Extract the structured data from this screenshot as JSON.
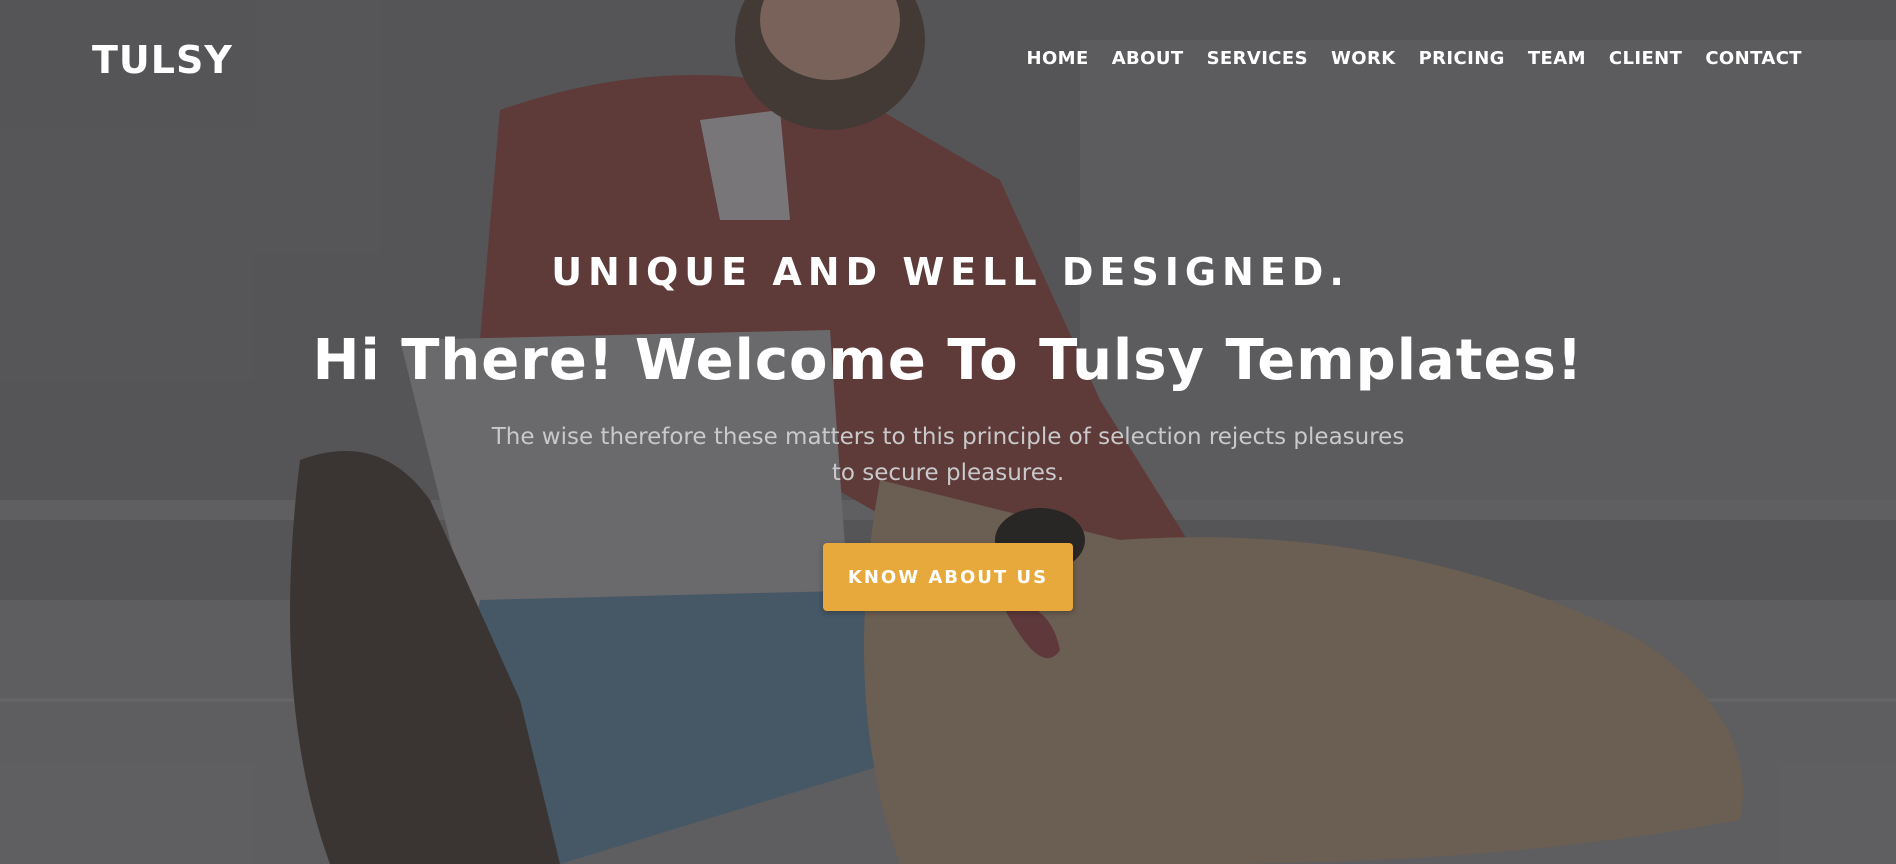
{
  "brand": {
    "logo_text": "TULSY"
  },
  "nav": {
    "items": [
      "HOME",
      "ABOUT",
      "SERVICES",
      "WORK",
      "PRICING",
      "TEAM",
      "CLIENT",
      "CONTACT"
    ]
  },
  "hero": {
    "eyebrow": "UNIQUE AND WELL DESIGNED.",
    "headline": "Hi There! Welcome To Tulsy Templates!",
    "subtext": "The wise therefore these matters to this principle of selection rejects pleasures to secure pleasures.",
    "cta_label": "KNOW ABOUT US"
  },
  "colors": {
    "accent": "#e8a93c",
    "text": "#ffffff",
    "muted_text": "#c9c9cb",
    "overlay": "#5d5c5e"
  }
}
